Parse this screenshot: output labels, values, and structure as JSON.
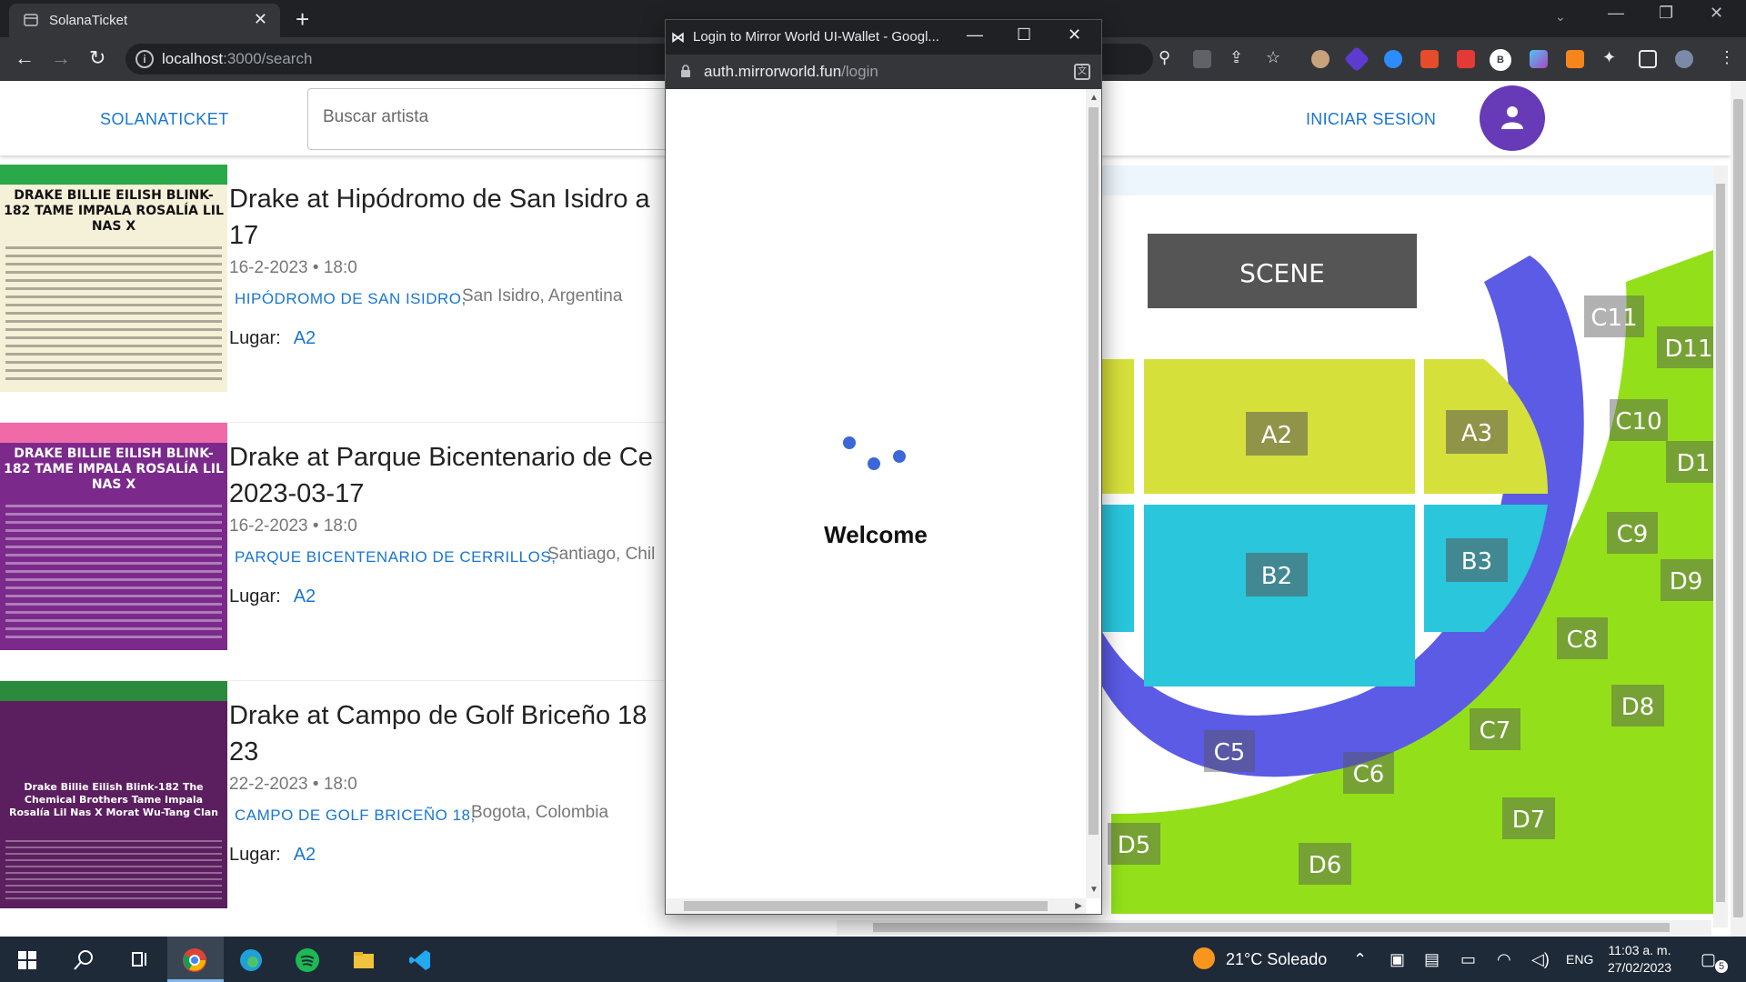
{
  "browser": {
    "tab_title": "SolanaTicket",
    "tab_close": "✕",
    "new_tab": "+",
    "url_host": "localhost",
    "url_path": ":3000/search"
  },
  "app": {
    "brand": "SOLANATICKET",
    "search_placeholder": "Buscar artista",
    "login_label": "INICIAR SESION"
  },
  "events": [
    {
      "title": "Drake at Hipódromo de San Isidro a 17",
      "date": "16-2-2023 • 18:0",
      "venue": "HIPÓDROMO DE SAN ISIDRO,",
      "city": "San Isidro, Argentina",
      "seat_label": "Lugar:",
      "seat": "A2",
      "poster_text": "DRAKE BILLIE EILISH BLINK-182 TAME IMPALA ROSALÍA LIL NAS X",
      "poster_bg": "#f5f0d8",
      "poster_accent": "#2aa84a"
    },
    {
      "title": "Drake at Parque Bicentenario de Ce 2023-03-17",
      "date": "16-2-2023 • 18:0",
      "venue": "PARQUE BICENTENARIO DE CERRILLOS,",
      "city": "Santiago, Chil",
      "seat_label": "Lugar:",
      "seat": "A2",
      "poster_text": "DRAKE BILLIE EILISH BLINK-182 TAME IMPALA ROSALÍA LIL NAS X",
      "poster_bg": "#7b2a8c",
      "poster_accent": "#f06aa8"
    },
    {
      "title": "Drake at Campo de Golf Briceño 18 23",
      "date": "22-2-2023 • 18:0",
      "venue": "CAMPO DE GOLF BRICEÑO 18,",
      "city": "Bogota, Colombia",
      "seat_label": "Lugar:",
      "seat": "A2",
      "poster_text": "Drake Billie Eilish Blink-182 The Chemical Brothers Tame Impala Rosalía Lil Nas X Morat Wu-Tang Clan",
      "poster_bg": "#5b1f5f",
      "poster_accent": "#2c8a3c"
    }
  ],
  "venue_map": {
    "scene": "SCENE",
    "colors": {
      "a": "#d6e03a",
      "b": "#29c6dc",
      "c": "#5b5be6",
      "d": "#93e01a",
      "label_bg": "#555555"
    },
    "sections": {
      "a2": "A2",
      "a3": "A3",
      "b2": "B2",
      "b3": "B3",
      "c5": "C5",
      "c6": "C6",
      "c7": "C7",
      "c8": "C8",
      "c9": "C9",
      "c10": "C10",
      "c11": "C11",
      "d5": "D5",
      "d6": "D6",
      "d7": "D7",
      "d8": "D8",
      "d9": "D9",
      "d10": "D1",
      "d11": "D11"
    }
  },
  "popup": {
    "window_title": "Login to Mirror World UI-Wallet - Googl...",
    "host": "auth.mirrorworld.fun",
    "path": "/login",
    "welcome": "Welcome"
  },
  "taskbar": {
    "weather": "21°C  Soleado",
    "lang": "ENG",
    "time": "11:03 a. m.",
    "date": "27/02/2023",
    "notifications": "5"
  }
}
